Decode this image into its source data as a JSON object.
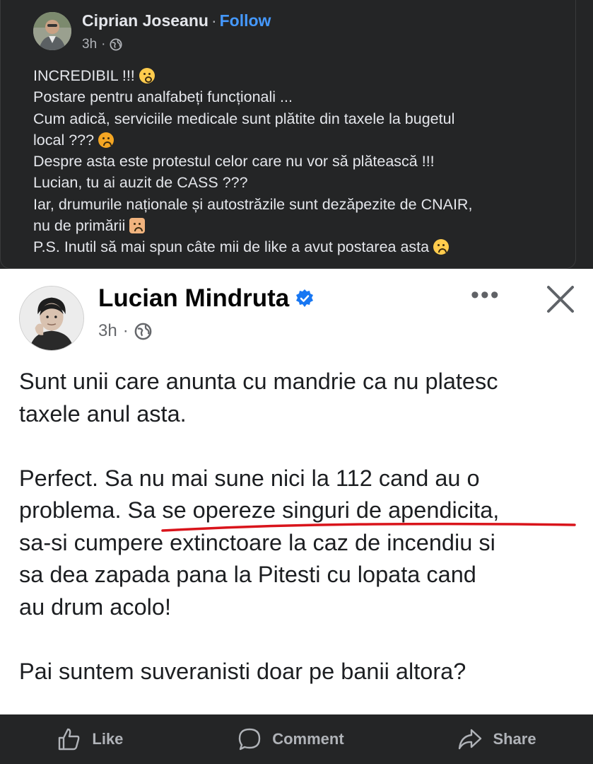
{
  "top_post": {
    "author": "Ciprian Joseanu",
    "separator": "·",
    "follow_label": "Follow",
    "time": "3h",
    "meta_separator": "·",
    "lines": [
      "INCREDIBIL !!!",
      "Postare pentru analfabeți funcționali ...",
      "Cum adică, serviciile medicale sunt plătite din taxele la bugetul",
      "local ???",
      "Despre asta este protestul celor care nu vor să plătească !!!",
      "Lucian, tu ai auzit de CASS ???",
      "Iar, drumurile naționale și autostrăzile sunt dezăpezite de CNAIR,",
      "nu de primării",
      "P.S. Inutil să mai spun câte mii de like a avut postarea asta"
    ]
  },
  "shared_screenshot": {
    "author": "Lucian Mindruta",
    "time": "3h",
    "meta_separator": "·",
    "more_label": "•••",
    "lines": [
      "Sunt unii care anunta cu mandrie ca nu platesc",
      "taxele anul asta.",
      "Perfect. Sa nu mai sune nici la 112 cand au o",
      "problema. Sa se opereze singuri de apendicita,",
      "sa-si cumpere extinctoare la caz de incendiu si",
      "sa dea zapada pana la Pitesti cu lopata cand",
      "au drum acolo!",
      "Pai suntem suveranisti doar pe banii altora?"
    ],
    "underline_color": "#d9141b"
  },
  "actions": {
    "like": "Like",
    "comment": "Comment",
    "share": "Share"
  },
  "colors": {
    "dark_bg": "#242526",
    "link_blue": "#4599ff",
    "verified_blue": "#1877f2"
  }
}
